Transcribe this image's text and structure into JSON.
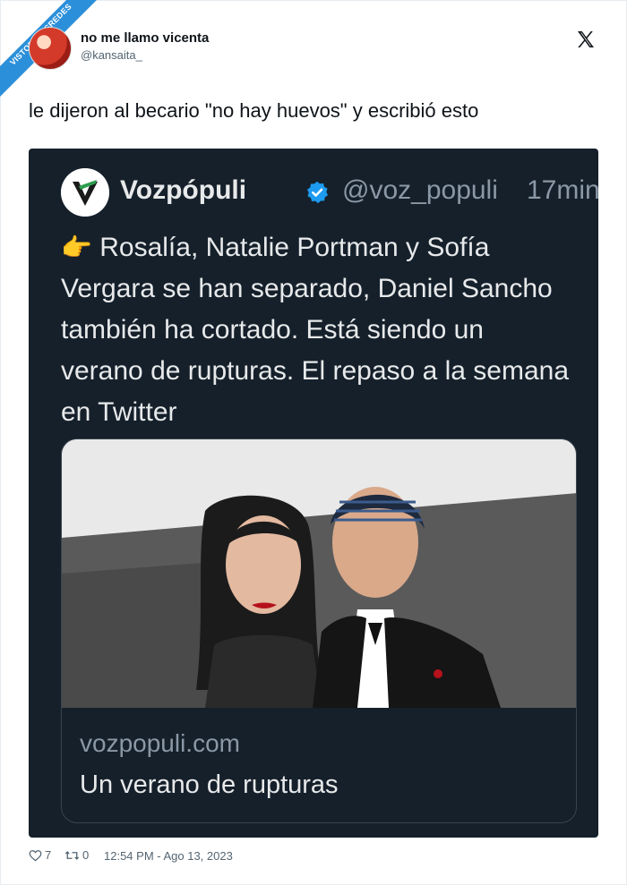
{
  "watermark": {
    "line1": "VISTOENLASREDES",
    "line2": ".com"
  },
  "author": {
    "name": "no me llamo vicenta",
    "handle": "@kansaita_"
  },
  "tweet": {
    "text": "le dijeron al becario \"no hay huevos\" y escribió esto"
  },
  "quoted": {
    "name": "Vozpópuli",
    "handle": "@voz_populi",
    "time": "17min",
    "emoji": "👉",
    "text": "Rosalía, Natalie Portman y Sofía Vergara se han separado, Daniel Sancho también ha cortado. Está siendo un verano de rupturas. El repaso a la semana en Twitter",
    "card": {
      "domain": "vozpopuli.com",
      "title": "Un verano de rupturas"
    }
  },
  "footer": {
    "likes": "7",
    "retweets": "0",
    "timestamp": "12:54 PM - Ago 13, 2023"
  },
  "colors": {
    "embed_bg": "#15202b",
    "verified": "#1d9bf0",
    "logo_green": "#2e9e4f"
  }
}
